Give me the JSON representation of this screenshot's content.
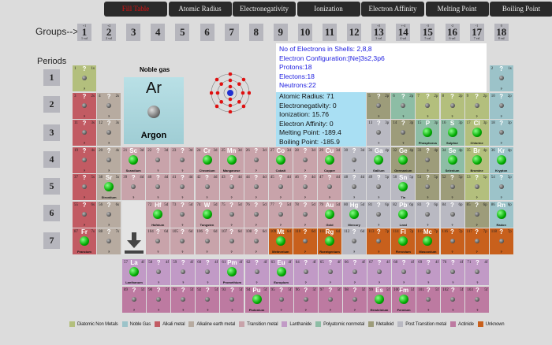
{
  "tabs": [
    {
      "label": "Fill Table",
      "active": true
    },
    {
      "label": "Atomic Radius"
    },
    {
      "label": "Electronegativity"
    },
    {
      "label": "Ionization"
    },
    {
      "label": "Electron Affinity"
    },
    {
      "label": "Melting Point"
    },
    {
      "label": "Boiling Point"
    }
  ],
  "groups_label": "Groups-->",
  "groups": [
    {
      "n": "1",
      "t": "+1",
      "b": "1 val"
    },
    {
      "n": "2",
      "t": "+2",
      "b": "2 val"
    },
    {
      "n": "3"
    },
    {
      "n": "4"
    },
    {
      "n": "5"
    },
    {
      "n": "6"
    },
    {
      "n": "7"
    },
    {
      "n": "8"
    },
    {
      "n": "9"
    },
    {
      "n": "10"
    },
    {
      "n": "11"
    },
    {
      "n": "12"
    },
    {
      "n": "13",
      "t": "+3",
      "b": "3 val"
    },
    {
      "n": "14",
      "t": "+-4",
      "b": "4 val"
    },
    {
      "n": "15",
      "t": "-3",
      "b": "5 val"
    },
    {
      "n": "16",
      "t": "-2",
      "b": "6 val"
    },
    {
      "n": "17",
      "t": "-1",
      "b": "7 val"
    },
    {
      "n": "18",
      "t": "0",
      "b": "8 val"
    }
  ],
  "periods_label": "Periods",
  "periods": [
    "1",
    "2",
    "3",
    "4",
    "5",
    "6",
    "7"
  ],
  "selected": {
    "category": "Noble gas",
    "symbol": "Ar",
    "name": "Argon",
    "shells": "No of Electrons in Shells: 2,8,8",
    "config": "Electron Configuration:[Ne]3s2,3p6",
    "protons": "Protons:18",
    "electrons": "Electons:18",
    "neutrons": "Neutrons:22",
    "radius": "Atomic Radius: 71",
    "electroneg": "Electronegativity: 0",
    "ionization": "Ionization: 15.76",
    "affinity": "Electron Affinity: 0",
    "melting": "Melting Point: -189.4",
    "boiling": "Boiling Point: -185.9"
  },
  "colors": {
    "am": "#c25b63",
    "ae": "#b7aba0",
    "tm": "#c8a3aa",
    "la": "#c19ac6",
    "ac": "#bd7aa1",
    "ng": "#9cc3c9",
    "dn": "#b3bf7d",
    "pn": "#8dbda5",
    "md": "#9d9c7a",
    "pt": "#b9b9c2",
    "un": "#c8601c"
  },
  "legend": [
    {
      "label": "Diatomic Non Metals",
      "cat": "dn"
    },
    {
      "label": "Noble Gas",
      "cat": "ng"
    },
    {
      "label": "Alkali metal",
      "cat": "am"
    },
    {
      "label": "Alkaline earth metal",
      "cat": "ae"
    },
    {
      "label": "Transition metal",
      "cat": "tm"
    },
    {
      "label": "Lanthanide",
      "cat": "la"
    },
    {
      "label": "Polyatomic nonmetal",
      "cat": "pn"
    },
    {
      "label": "Metalloid",
      "cat": "md"
    },
    {
      "label": "Post Transition metal",
      "cat": "pt"
    },
    {
      "label": "Actinide",
      "cat": "ac"
    },
    {
      "label": "Unknown",
      "cat": "un"
    }
  ],
  "elements": [
    "1|?|?|1s|dn",
    "2|?|?|1s|ng",
    "3|?|?|2s|am",
    "4|?|?|2s|ae",
    "5|?|?|2p|md",
    "6|?|?|2p|pn",
    "7|?|?|2p|dn",
    "8|?|?|2p|dn",
    "9|?|?|2p|dn",
    "10|?|?|2p|ng",
    "11|?|?|3s|am",
    "12|?|?|3s|ae",
    "13|?|?|3p|pt",
    "14|?|?|3p|md",
    "15|P|Phosphorus|3p|pn",
    "16|S|Sulphur|3p|pn",
    "17|Cl|Chlorine|3p|dn",
    "18|?|?|3p|ng",
    "19|?|?|4s|am",
    "20|?|?|4s|ae",
    "21|Sc|Scandium|3d|tm",
    "22|?|?|3d|tm",
    "23|?|?|3d|tm",
    "24|Cr|Chromium|3d|tm",
    "25|Mn|Manganese|3d|tm",
    "26|?|?|3d|tm",
    "27|Co|Cobalt|3d|tm",
    "28|?|?|3d|tm",
    "29|Cu|Copper|3d|tm",
    "30|?|?|3d|pt",
    "31|Ga|Gallium|4p|pt",
    "32|Ge|Germanium|4p|md",
    "33|?|?|4p|md",
    "34|Se|Selenium|4p|pn",
    "35|Br|Bromine|4p|dn",
    "36|Kr|Krypton|4p|ng",
    "37|?|?|5s|am",
    "38|Sr|Strontium|5s|ae",
    "39|?|?|4d|tm",
    "40|?|?|4d|tm",
    "41|?|?|4d|tm",
    "42|?|?|4d|tm",
    "43|?|?|4d|tm",
    "44|?|?|4d|tm",
    "45|?|?|4d|tm",
    "46|?|?|4d|tm",
    "47|?|?|4d|tm",
    "48|?|?|4d|pt",
    "49|?|?|5p|pt",
    "50|Sn|Tin|5p|pt",
    "51|?|?|5p|md",
    "52|?|?|5p|md",
    "53|?|?|5p|dn",
    "54|?|?|5p|ng",
    "55|?|?|6s|am",
    "56|?|?|6s|ae",
    "72|Hf|Hafnium|5d|tm",
    "73|?|?|5d|tm",
    "74|W|Tungsten|5d|tm",
    "75|?|?|5d|tm",
    "76|?|?|5d|tm",
    "77|?|?|5d|tm",
    "78|?|?|5d|tm",
    "79|Au|Gold|5d|tm",
    "80|Hg|Mercury|5d|pt",
    "81|?|?|6p|pt",
    "82|Pb|Lead|6p|pt",
    "83|?|?|6p|pt",
    "84|?|?|6p|pt",
    "85|?|?|6p|md",
    "86|Rn|Radon|6p|ng",
    "87|Fr|Francium|7s|am",
    "88|?|?|7s|ae",
    "104|?|?|6d|tm",
    "105|?|?|6d|tm",
    "106|?|?|6d|tm",
    "107|?|?|6d|tm",
    "108|?|?|6d|tm",
    "109|Mt|Meitnerium|6d|un",
    "110|?|?|6d|un",
    "111|Rg|Roentgenium|6d|un",
    "112|?|?|6d|pt",
    "113|?|?|7p|un",
    "114|Fl|Flerovium|7p|un",
    "115|Mc|Moscovium|7p|un",
    "116|?|?|7p|un",
    "117|?|?|7p|un",
    "118|?|?|7p|un",
    "57|La|Lanthanum|4f|la",
    "58|?|?|4f|la",
    "59|?|?|4f|la",
    "60|?|?|4f|la",
    "61|Pm|Promethium|4f|la",
    "62|?|?|4f|la",
    "63|Eu|Europium|4f|la",
    "64|?|?|4f|la",
    "65|?|?|4f|la",
    "66|?|?|4f|la",
    "67|?|?|4f|la",
    "68|?|?|4f|la",
    "69|?|?|4f|la",
    "70|?|?|4f|la",
    "71|?|?|4f|la",
    "89|?|?|5f|ac",
    "90|?|?|5f|ac",
    "91|?|?|5f|ac",
    "92|?|?|5f|ac",
    "93|?|?|5f|ac",
    "94|Pu|Plutonium|5f|ac",
    "95|?|?|5f|ac",
    "96|?|?|5f|ac",
    "97|?|?|5f|ac",
    "98|?|?|5f|ac",
    "99|Es|Einsteinium|5f|ac",
    "100|Fm|Fermium|5f|ac",
    "101|?|?|5f|ac",
    "102|?|?|5f|ac",
    "103|?|?|5f|ac"
  ]
}
